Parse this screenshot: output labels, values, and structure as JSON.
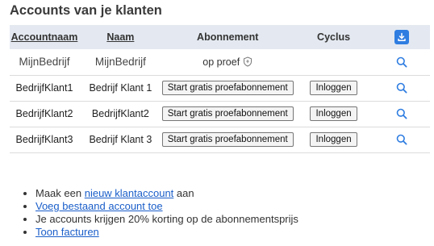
{
  "page_title": "Accounts van je klanten",
  "table": {
    "headers": {
      "account_name": "Accountnaam",
      "name": "Naam",
      "subscription": "Abonnement",
      "cycle": "Cyclus"
    },
    "own_row": {
      "account_name": "MijnBedrijf",
      "name": "MijnBedrijf",
      "status": "op proef"
    },
    "rows": [
      {
        "account_name": "BedrijfKlant1",
        "name": "Bedrijf Klant 1",
        "trial_button": "Start gratis proefabonnement",
        "login_button": "Inloggen"
      },
      {
        "account_name": "BedrijfKlant2",
        "name": "BedrijfKlant2",
        "trial_button": "Start gratis proefabonnement",
        "login_button": "Inloggen"
      },
      {
        "account_name": "BedrijfKlant3",
        "name": "Bedrijf Klant 3",
        "trial_button": "Start gratis proefabonnement",
        "login_button": "Inloggen"
      }
    ]
  },
  "info": {
    "item1_prefix": "Maak een",
    "item1_link": "nieuw klantaccount",
    "item1_suffix": "aan",
    "item2_link": "Voeg bestaand account toe",
    "item3_text": "Je accounts krijgen 20% korting op de abonnementsprijs",
    "item4_link": "Toon facturen"
  },
  "icons": {
    "download": "download-icon",
    "search": "search-icon",
    "trial_badge": "shield-icon"
  },
  "colors": {
    "header_bg": "#e4e9f1",
    "accent": "#2f7de1",
    "link": "#1a5ec9"
  }
}
